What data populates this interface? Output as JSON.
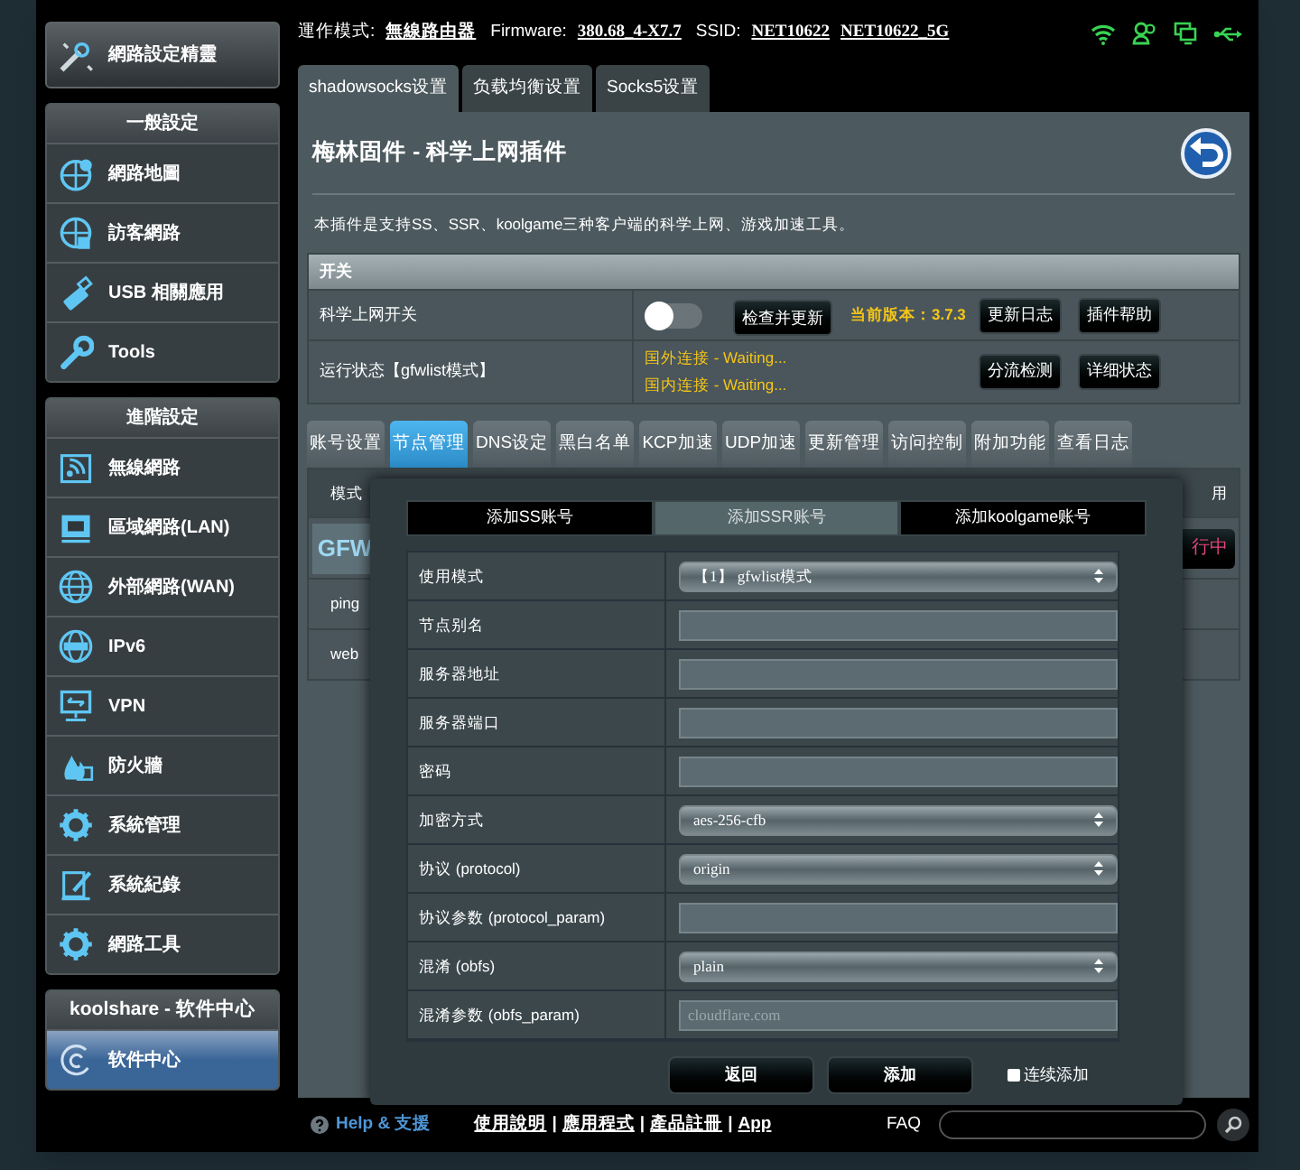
{
  "header": {
    "mode_label": "運作模式:",
    "mode": "無線路由器",
    "firmware_label": "Firmware:",
    "firmware": "380.68_4-X7.7",
    "ssid_label": "SSID:",
    "ssids": [
      "NET10622",
      "NET10622_5G"
    ]
  },
  "sidebar": {
    "wizard": "網路設定精靈",
    "groups": [
      {
        "title": "一般設定",
        "kind": "plain",
        "items": [
          {
            "label": "網路地圖",
            "kind": "map",
            "selected": false
          },
          {
            "label": "訪客網路",
            "kind": "guest",
            "selected": false
          },
          {
            "label": "USB 相關應用",
            "kind": "usb",
            "selected": false
          },
          {
            "label": "Tools",
            "kind": "tools",
            "selected": false
          }
        ]
      },
      {
        "title": "進階設定",
        "kind": "plain",
        "items": [
          {
            "label": "無線網路",
            "kind": "wireless",
            "selected": false
          },
          {
            "label": "區域網路(LAN)",
            "kind": "lan",
            "selected": false
          },
          {
            "label": "外部網路(WAN)",
            "kind": "globe",
            "selected": false
          },
          {
            "label": "IPv6",
            "kind": "ipv6",
            "selected": false
          },
          {
            "label": "VPN",
            "kind": "vpn",
            "selected": false
          },
          {
            "label": "防火牆",
            "kind": "fire",
            "selected": false
          },
          {
            "label": "系統管理",
            "kind": "gear",
            "selected": false
          },
          {
            "label": "系統紀錄",
            "kind": "log",
            "selected": false
          },
          {
            "label": "網路工具",
            "kind": "gear",
            "selected": false
          }
        ]
      },
      {
        "title": "koolshare - 软件中心",
        "kind": "store",
        "items": [
          {
            "label": "软件中心",
            "kind": "swirl",
            "selected": true
          }
        ]
      }
    ]
  },
  "top_tabs": [
    {
      "label": "shadowsocks设置",
      "selected": true
    },
    {
      "label": "负载均衡设置",
      "selected": false
    },
    {
      "label": "Socks5设置",
      "selected": false
    }
  ],
  "panel": {
    "title": "梅林固件 - 科学上网插件",
    "description": "本插件是支持SS、SSR、koolgame三种客户端的科学上网、游戏加速工具。",
    "switch_table": {
      "header": "开关",
      "rows": [
        {
          "kind": "switch",
          "label": "科学上网开关",
          "on": false,
          "button": "检查并更新",
          "version": "当前版本：3.7.3",
          "actions": [
            "更新日志",
            "插件帮助"
          ]
        },
        {
          "kind": "status",
          "label": "运行状态【gfwlist模式】",
          "lines": [
            "国外连接 - Waiting...",
            "国内连接 - Waiting..."
          ],
          "actions": [
            "分流检测",
            "详细状态"
          ]
        }
      ]
    },
    "sub_tabs": [
      {
        "label": "账号设置",
        "selected": false
      },
      {
        "label": "节点管理",
        "selected": true
      },
      {
        "label": "DNS设定",
        "selected": false
      },
      {
        "label": "黑白名单",
        "selected": false
      },
      {
        "label": "KCP加速",
        "selected": false
      },
      {
        "label": "UDP加速",
        "selected": false
      },
      {
        "label": "更新管理",
        "selected": false
      },
      {
        "label": "访问控制",
        "selected": false
      },
      {
        "label": "附加功能",
        "selected": false
      },
      {
        "label": "查看日志",
        "selected": false
      }
    ],
    "node_table": {
      "columns": [
        "模式",
        "用"
      ],
      "logo": "GFW",
      "status": "行中",
      "tests": [
        "ping",
        "web"
      ]
    }
  },
  "dialog": {
    "tabs": [
      {
        "label": "添加SS账号",
        "selected": false
      },
      {
        "label": "添加SSR账号",
        "selected": true
      },
      {
        "label": "添加koolgame账号",
        "selected": false
      }
    ],
    "fields": [
      {
        "label": "使用模式",
        "kind": "select",
        "value": "【1】 gfwlist模式"
      },
      {
        "label": "节点别名",
        "kind": "input"
      },
      {
        "label": "服务器地址",
        "kind": "input"
      },
      {
        "label": "服务器端口",
        "kind": "input"
      },
      {
        "label": "密码",
        "kind": "input"
      },
      {
        "label": "加密方式",
        "kind": "select",
        "value": "aes-256-cfb"
      },
      {
        "label": "协议 (protocol)",
        "kind": "select",
        "value": "origin"
      },
      {
        "label": "协议参数 (protocol_param)",
        "kind": "input"
      },
      {
        "label": "混淆 (obfs)",
        "kind": "select",
        "value": "plain"
      },
      {
        "label": "混淆参数 (obfs_param)",
        "kind": "input",
        "placeholder": "cloudflare.com"
      }
    ],
    "buttons": [
      "返回",
      "添加"
    ],
    "continuous": {
      "label": "连续添加",
      "checked": false
    }
  },
  "footer": {
    "help": "Help & 支援",
    "links": [
      "使用說明",
      "應用程式",
      "產品註冊",
      "App"
    ],
    "separator": "|",
    "faq": "FAQ"
  }
}
